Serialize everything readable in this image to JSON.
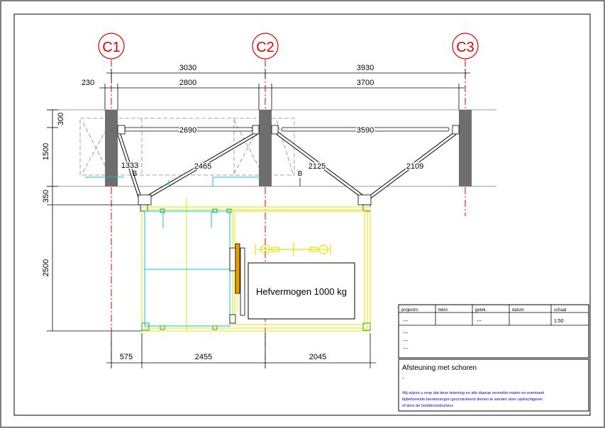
{
  "grid_labels": [
    "C1",
    "C2",
    "C3"
  ],
  "dimensions": {
    "top_spans": [
      "3030",
      "3930"
    ],
    "inner_spans": [
      "230",
      "2800",
      "3700"
    ],
    "left_300": "300",
    "left_1500": "1500",
    "left_350": "350",
    "left_2500": "2500",
    "bottom_575": "575",
    "bottom_2455": "2455",
    "bottom_2045": "2045"
  },
  "struts": {
    "horizontal_1": "2690",
    "horizontal_2": "3590",
    "diagonal_1333": "1333",
    "diagonal_2465": "2465",
    "diagonal_2125": "2125",
    "diagonal_2109": "2109"
  },
  "section_marks": [
    "B",
    "B"
  ],
  "lift_label": "Hefvermogen 1000 kg",
  "title_block": {
    "headers": [
      "projectnr.",
      "teknr.",
      "getek.",
      "datum",
      "schaal"
    ],
    "values": [
      "---",
      "",
      "---",
      "",
      "1:50"
    ],
    "revisions": [
      "---",
      "---",
      "---"
    ],
    "title": "Afsteuning met schoren",
    "subtitle": "-",
    "note": "Wij wijzen u erop dat deze tekening en alle daarop vermelde maten en eventueel bijbehorende berekeningen gecontroleerd dienen te worden door opdrachtgever of door de hoofdconstructeur.",
    "note_lines": [
      "Wij wijzen u erop dat deze tekening en alle daarop vermelde maten  en eventueel",
      "bijbehorende berekeningen gecontroleerd dienen te worden door opdrachtgever",
      "of door de hoofdconstructeur."
    ]
  },
  "colors": {
    "axis_red": "#e00000",
    "column_gray": "#6e6e6e",
    "cyan": "#00c8d8",
    "yellow": "#e8e000",
    "note_blue": "#0000c0"
  }
}
